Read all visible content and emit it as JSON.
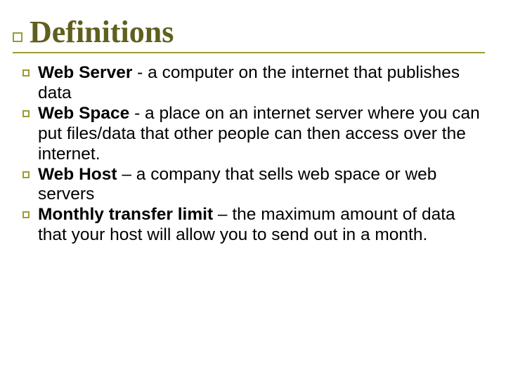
{
  "title": "Definitions",
  "items": [
    {
      "term": "Web Server",
      "def": " - a computer on the internet that publishes data"
    },
    {
      "term": "Web Space",
      "def": " - a place on an internet server where you can put files/data that other people can then access over the internet."
    },
    {
      "term": "Web Host",
      "def": " – a company that sells web space or web servers"
    },
    {
      "term": "Monthly transfer limit",
      "def": " – the maximum amount of data that your host will allow you to send out in a month."
    }
  ]
}
